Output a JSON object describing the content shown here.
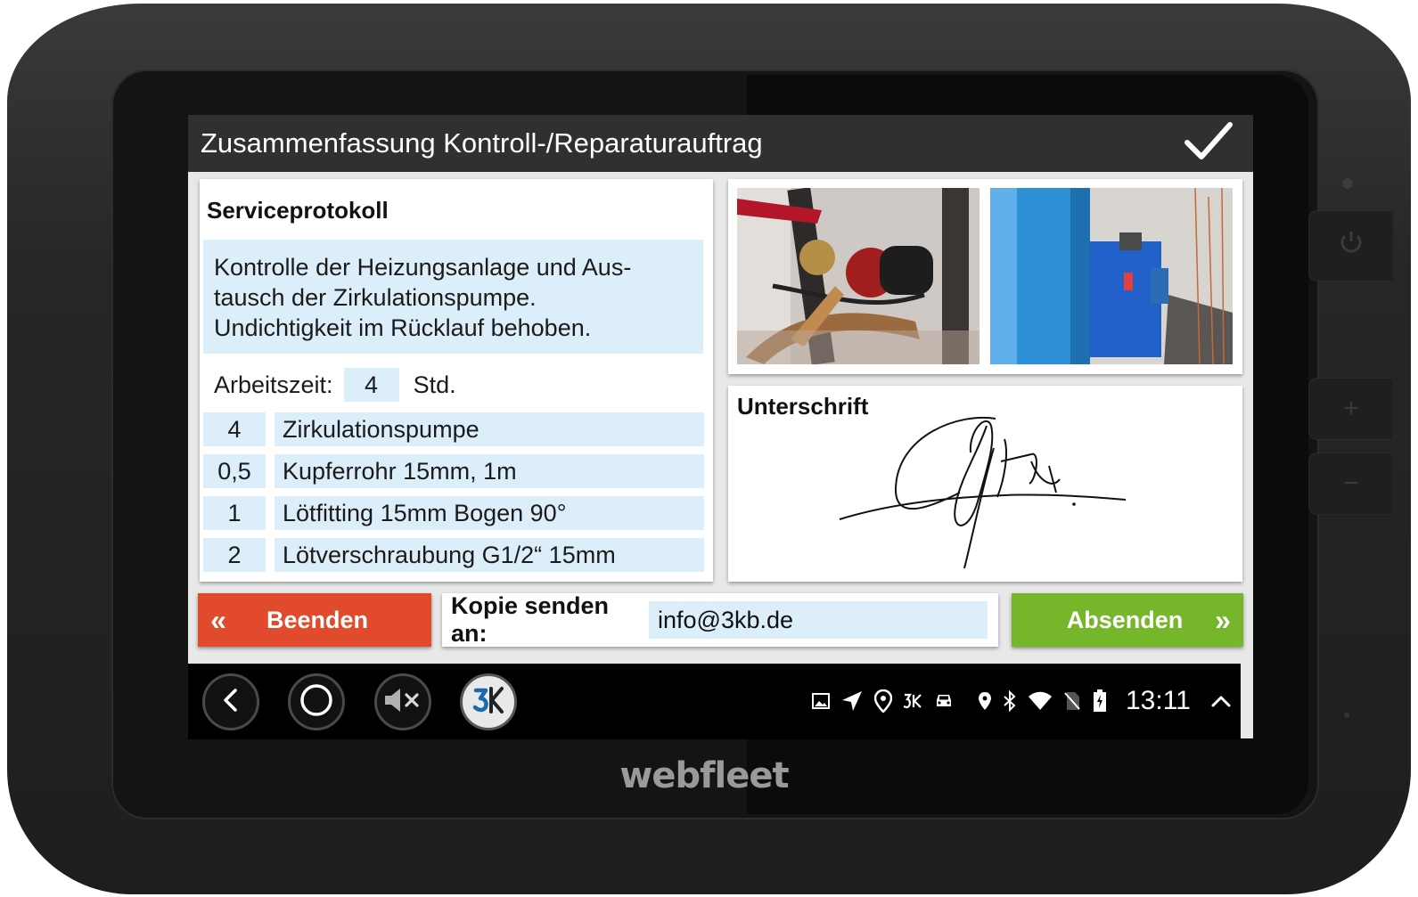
{
  "app": {
    "title": "Zusammenfassung Kontroll-/Reparaturauftrag"
  },
  "protocol": {
    "heading": "Serviceprotokoll",
    "description_lines": [
      "Kontrolle der Heizungsanlage und Aus-",
      "tausch der Zirkulationspumpe.",
      "Undichtigkeit im Rücklauf behoben."
    ],
    "worktime_label": "Arbeitszeit:",
    "worktime_value": "4",
    "worktime_unit": "Std.",
    "items": [
      {
        "qty": "4",
        "name": "Zirkulationspumpe"
      },
      {
        "qty": "0,5",
        "name": "Kupferrohr 15mm, 1m"
      },
      {
        "qty": "1",
        "name": "Lötfitting 15mm Bogen 90°"
      },
      {
        "qty": "2",
        "name": "Lötverschraubung G1/2“ 15mm"
      }
    ]
  },
  "signature": {
    "heading": "Unterschrift"
  },
  "actions": {
    "stop_label": "Beenden",
    "stop_arrow": "«",
    "copy_label": "Kopie senden an:",
    "copy_value": "info@3kb.de",
    "send_label": "Absenden",
    "send_arrow": "»"
  },
  "statusbar": {
    "time": "13:11"
  },
  "device": {
    "brand": "webfleet"
  },
  "colors": {
    "titlebar": "#303030",
    "field_bg": "#ddeefb",
    "stop_button": "#e14a2d",
    "send_button": "#76b62a"
  }
}
